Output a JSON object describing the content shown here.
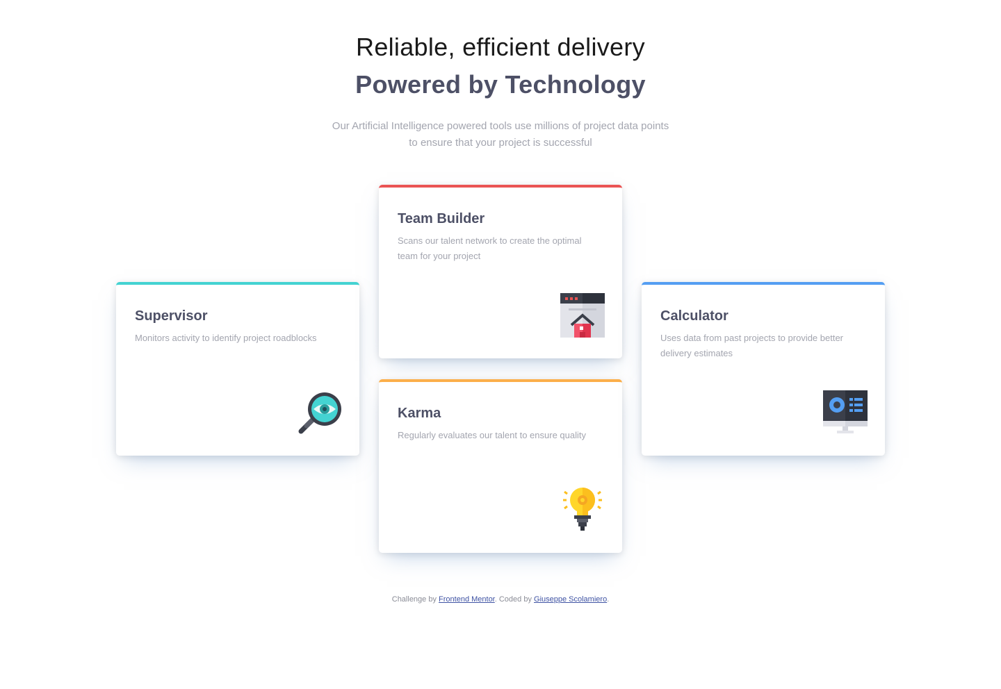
{
  "header": {
    "headline_light": "Reliable, efficient delivery",
    "headline_bold": "Powered by Technology",
    "intro": "Our Artificial Intelligence powered tools use millions of project data points to ensure that your project is successful"
  },
  "cards": {
    "supervisor": {
      "title": "Supervisor",
      "description": "Monitors activity to identify project roadblocks",
      "accent": "#44d3d2",
      "icon": "magnifier-eye-icon"
    },
    "team_builder": {
      "title": "Team Builder",
      "description": "Scans our talent network to create the optimal team for your project",
      "accent": "#ea5454",
      "icon": "browser-house-icon"
    },
    "karma": {
      "title": "Karma",
      "description": "Regularly evaluates our talent to ensure quality",
      "accent": "#fcaf4a",
      "icon": "lightbulb-icon"
    },
    "calculator": {
      "title": "Calculator",
      "description": "Uses data from past projects to provide better delivery estimates",
      "accent": "#549ef2",
      "icon": "monitor-chart-icon"
    }
  },
  "footer": {
    "prefix": "Challenge by ",
    "link1": "Frontend Mentor",
    "middle": ". Coded by ",
    "link2": "Giuseppe Scolamiero",
    "suffix": "."
  }
}
